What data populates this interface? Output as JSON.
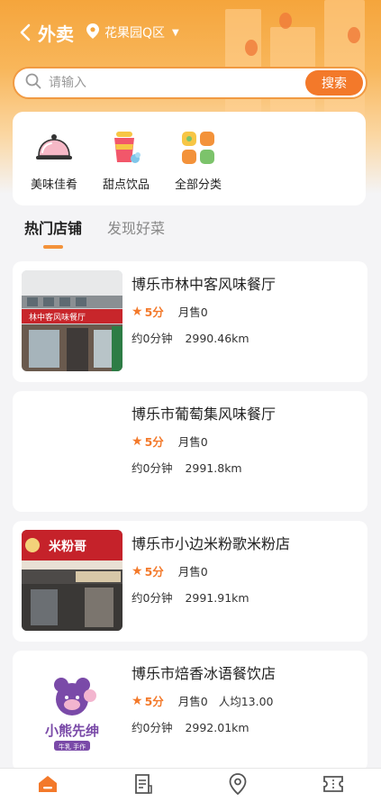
{
  "header": {
    "title": "外卖",
    "location": "花果园Q区"
  },
  "search": {
    "placeholder": "请输入",
    "button_label": "搜索"
  },
  "categories": [
    {
      "label": "美味佳肴",
      "icon": "food-cloche-icon"
    },
    {
      "label": "甜点饮品",
      "icon": "drink-cup-icon"
    },
    {
      "label": "全部分类",
      "icon": "all-grid-icon"
    }
  ],
  "tabs": [
    {
      "label": "热门店铺",
      "active": true
    },
    {
      "label": "发现好菜",
      "active": false
    }
  ],
  "shops": [
    {
      "name": "博乐市林中客风味餐厅",
      "score": "5分",
      "sold": "月售0",
      "avg": "",
      "time": "约0分钟",
      "distance": "2990.46km",
      "thumb_sign": "林中客风味餐厅"
    },
    {
      "name": "博乐市葡萄集风味餐厅",
      "score": "5分",
      "sold": "月售0",
      "avg": "",
      "time": "约0分钟",
      "distance": "2991.8km",
      "thumb_sign": ""
    },
    {
      "name": "博乐市小边米粉歌米粉店",
      "score": "5分",
      "sold": "月售0",
      "avg": "",
      "time": "约0分钟",
      "distance": "2991.91km",
      "thumb_sign": "米粉哥"
    },
    {
      "name": "博乐市焙香冰语餐饮店",
      "score": "5分",
      "sold": "月售0",
      "avg": "人均13.00",
      "time": "约0分钟",
      "distance": "2992.01km",
      "thumb_sign": "小熊先绅"
    }
  ],
  "logo": {
    "brand": "小熊先绅",
    "tag": "牛乳 手作"
  },
  "bottom_nav": [
    {
      "icon": "home-icon",
      "active": true
    },
    {
      "icon": "orders-icon",
      "active": false
    },
    {
      "icon": "location-icon",
      "active": false
    },
    {
      "icon": "coupon-icon",
      "active": false
    }
  ],
  "colors": {
    "accent": "#f3792a",
    "banner": "#f5a53c"
  }
}
